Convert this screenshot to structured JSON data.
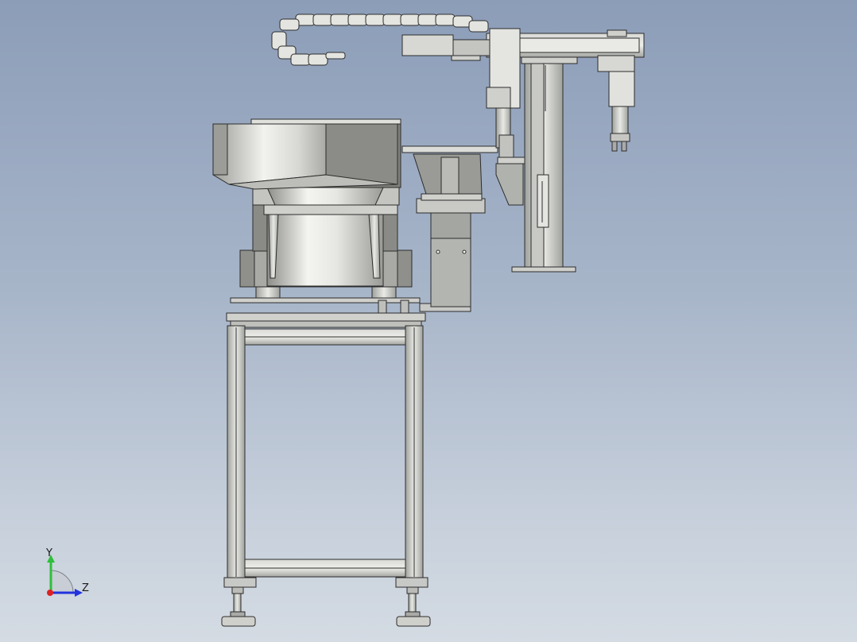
{
  "triad": {
    "y_label": "Y",
    "z_label": "Z",
    "y_color": "#2fbf3a",
    "z_color": "#2233dd",
    "x_color": "#dd2222"
  },
  "colors": {
    "frame": "#c7c9c6",
    "frame_dark": "#7d7f7c",
    "outline": "#2c2c2c",
    "bowl_light": "#eeeeea",
    "bowl_dark": "#8e8f8a",
    "metal": "#d3d4d0"
  }
}
